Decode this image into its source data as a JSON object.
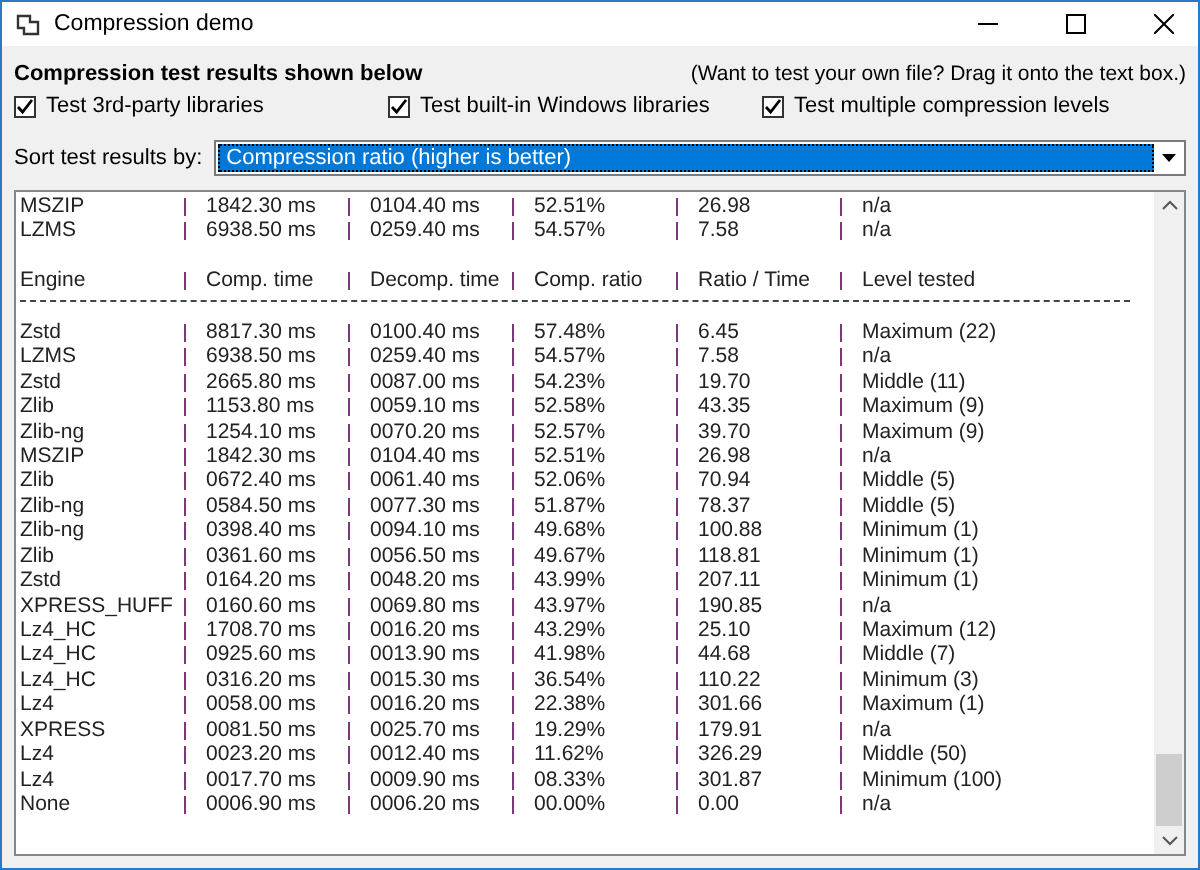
{
  "window": {
    "title": "Compression demo"
  },
  "heading": "Compression test results shown below",
  "hint": "(Want to test your own file?  Drag it onto the text box.)",
  "options": [
    {
      "label": "Test 3rd-party libraries",
      "checked": true
    },
    {
      "label": "Test built-in Windows libraries",
      "checked": true
    },
    {
      "label": "Test multiple compression levels",
      "checked": true
    }
  ],
  "sort": {
    "label": "Sort test results by:",
    "value": "Compression ratio (higher is better)"
  },
  "results": {
    "earlier_rows": [
      [
        "MSZIP",
        "1842.30 ms",
        "0104.40 ms",
        "52.51%",
        "26.98",
        "n/a"
      ],
      [
        "LZMS",
        "6938.50 ms",
        "0259.40 ms",
        "54.57%",
        "7.58",
        "n/a"
      ]
    ],
    "columns": [
      "Engine",
      "Comp. time",
      "Decomp. time",
      "Comp. ratio",
      "Ratio / Time",
      "Level tested"
    ],
    "rows": [
      [
        "Zstd",
        "8817.30 ms",
        "0100.40 ms",
        "57.48%",
        "6.45",
        "Maximum (22)"
      ],
      [
        "LZMS",
        "6938.50 ms",
        "0259.40 ms",
        "54.57%",
        "7.58",
        "n/a"
      ],
      [
        "Zstd",
        "2665.80 ms",
        "0087.00 ms",
        "54.23%",
        "19.70",
        "Middle (11)"
      ],
      [
        "Zlib",
        "1153.80 ms",
        "0059.10 ms",
        "52.58%",
        "43.35",
        "Maximum (9)"
      ],
      [
        "Zlib-ng",
        "1254.10 ms",
        "0070.20 ms",
        "52.57%",
        "39.70",
        "Maximum (9)"
      ],
      [
        "MSZIP",
        "1842.30 ms",
        "0104.40 ms",
        "52.51%",
        "26.98",
        "n/a"
      ],
      [
        "Zlib",
        "0672.40 ms",
        "0061.40 ms",
        "52.06%",
        "70.94",
        "Middle (5)"
      ],
      [
        "Zlib-ng",
        "0584.50 ms",
        "0077.30 ms",
        "51.87%",
        "78.37",
        "Middle (5)"
      ],
      [
        "Zlib-ng",
        "0398.40 ms",
        "0094.10 ms",
        "49.68%",
        "100.88",
        "Minimum (1)"
      ],
      [
        "Zlib",
        "0361.60 ms",
        "0056.50 ms",
        "49.67%",
        "118.81",
        "Minimum (1)"
      ],
      [
        "Zstd",
        "0164.20 ms",
        "0048.20 ms",
        "43.99%",
        "207.11",
        "Minimum (1)"
      ],
      [
        "XPRESS_HUFF",
        "0160.60 ms",
        "0069.80 ms",
        "43.97%",
        "190.85",
        "n/a"
      ],
      [
        "Lz4_HC",
        "1708.70 ms",
        "0016.20 ms",
        "43.29%",
        "25.10",
        "Maximum (12)"
      ],
      [
        "Lz4_HC",
        "0925.60 ms",
        "0013.90 ms",
        "41.98%",
        "44.68",
        "Middle (7)"
      ],
      [
        "Lz4_HC",
        "0316.20 ms",
        "0015.30 ms",
        "36.54%",
        "110.22",
        "Minimum (3)"
      ],
      [
        "Lz4",
        "0058.00 ms",
        "0016.20 ms",
        "22.38%",
        "301.66",
        "Maximum (1)"
      ],
      [
        "XPRESS",
        "0081.50 ms",
        "0025.70 ms",
        "19.29%",
        "179.91",
        "n/a"
      ],
      [
        "Lz4",
        "0023.20 ms",
        "0012.40 ms",
        "11.62%",
        "326.29",
        "Middle (50)"
      ],
      [
        "Lz4",
        "0017.70 ms",
        "0009.90 ms",
        "08.33%",
        "301.87",
        "Minimum (100)"
      ],
      [
        "None",
        "0006.90 ms",
        "0006.20 ms",
        "00.00%",
        "0.00",
        "n/a"
      ]
    ]
  }
}
